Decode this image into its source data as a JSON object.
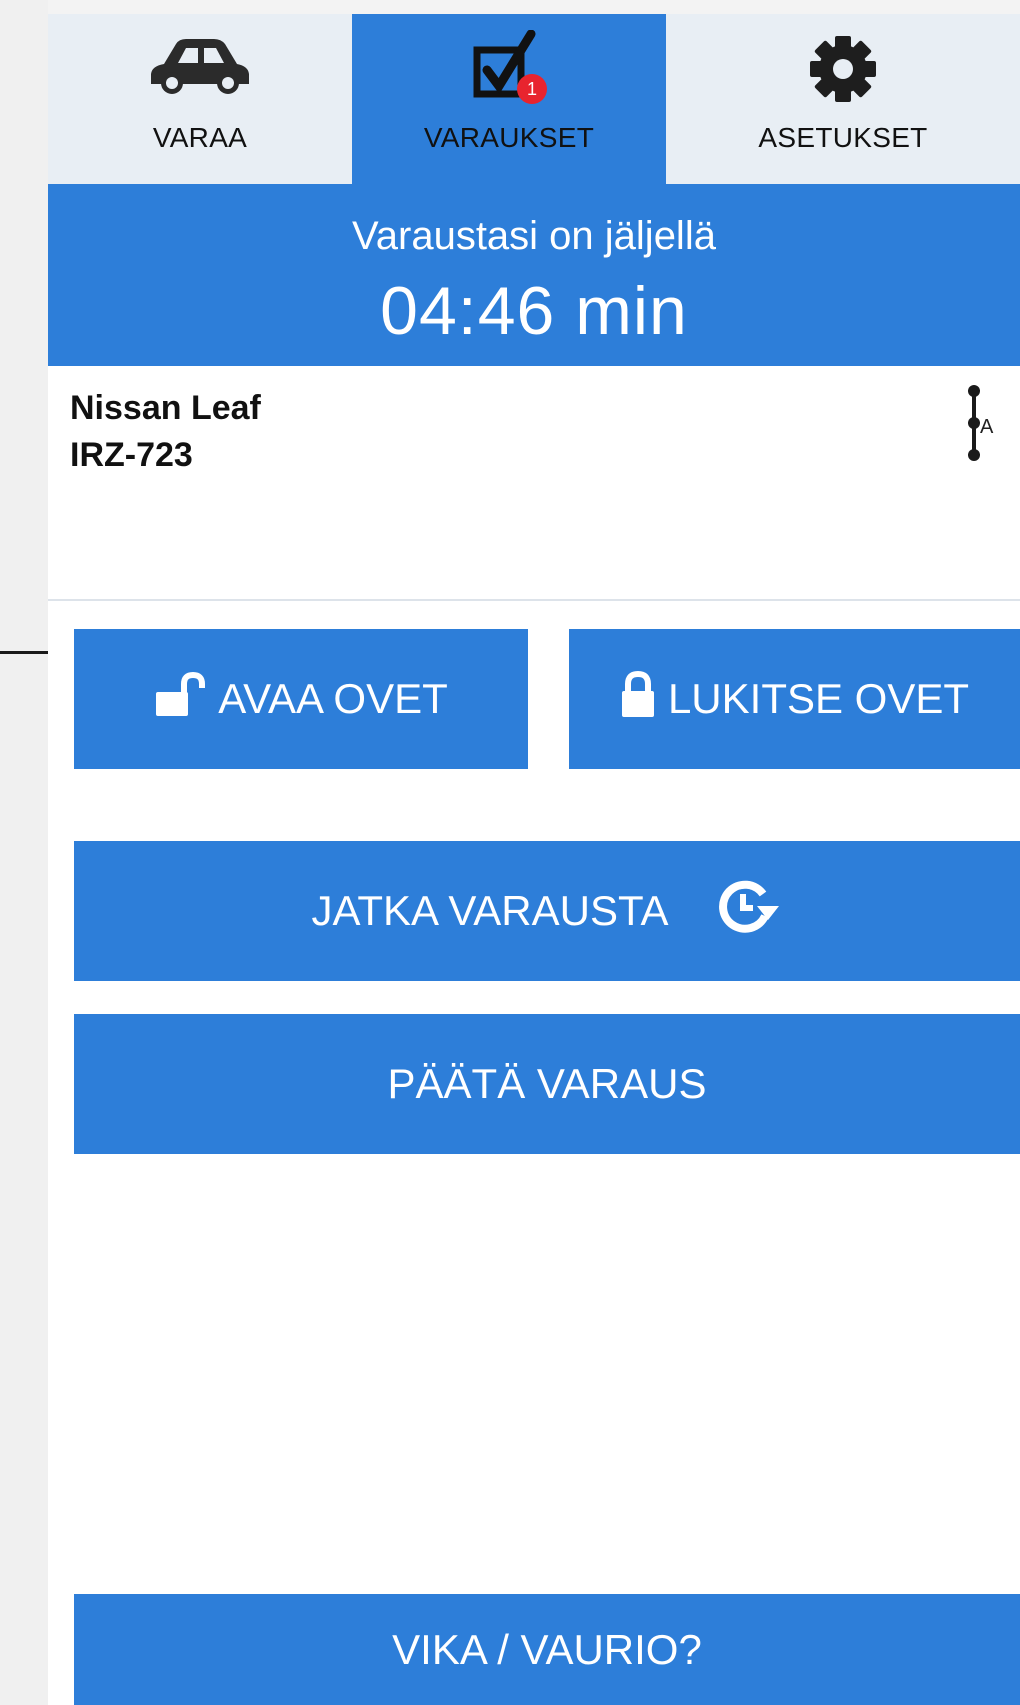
{
  "tabs": [
    {
      "label": "VARAA",
      "icon": "car-icon",
      "active": false
    },
    {
      "label": "VARAUKSET",
      "icon": "checkbox-icon",
      "active": true,
      "badge": "1"
    },
    {
      "label": "ASETUKSET",
      "icon": "gear-icon",
      "active": false
    }
  ],
  "timer": {
    "title": "Varaustasi on jäljellä",
    "value": "04:46 min"
  },
  "car": {
    "name": "Nissan Leaf",
    "plate": "IRZ-723",
    "handle_letter": "A"
  },
  "actions": {
    "open_doors": "AVAA OVET",
    "lock_doors": "LUKITSE OVET",
    "extend": "JATKA VARAUSTA",
    "end": "PÄÄTÄ VARAUS",
    "report": "VIKA / VAURIO?"
  },
  "colors": {
    "accent": "#2d7ed9",
    "tab_background": "#e8eef4",
    "badge": "#e8242e"
  }
}
